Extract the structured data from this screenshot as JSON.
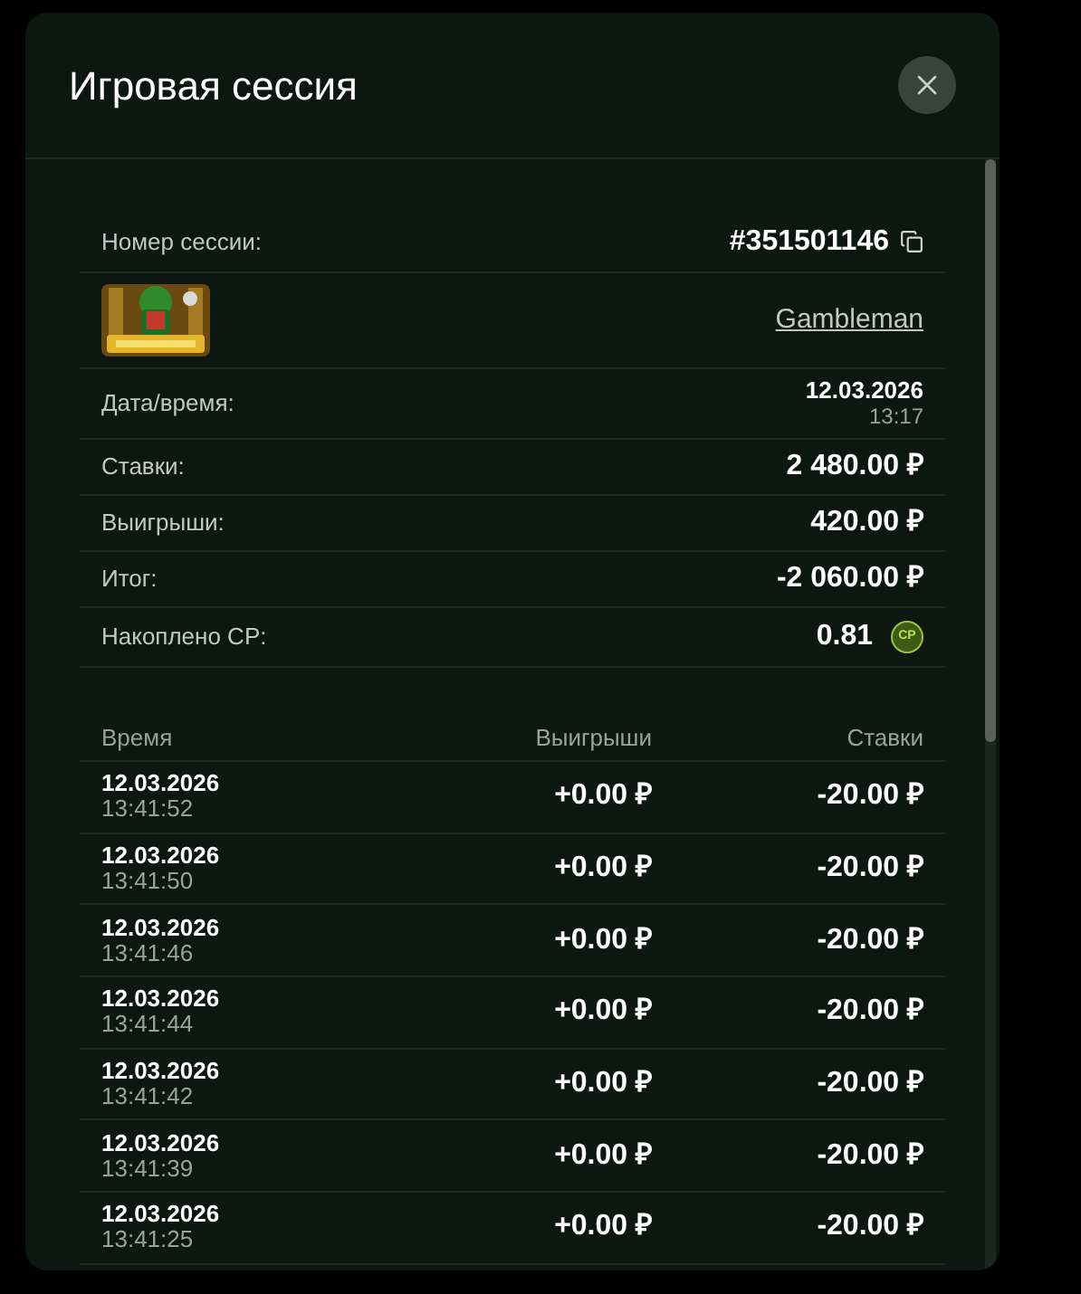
{
  "dialog": {
    "title": "Игровая сессия"
  },
  "session": {
    "number_label": "Номер сессии:",
    "number": "#351501146",
    "game": {
      "name": "Gambleman"
    },
    "details": [
      {
        "label": "Дата/время:",
        "value": "12.03.2026",
        "subvalue": "13:17"
      },
      {
        "label": "Ставки:",
        "value": "2 480.00 ₽"
      },
      {
        "label": "Выигрыши:",
        "value": "420.00 ₽"
      },
      {
        "label": "Итог:",
        "value": "-2 060.00 ₽"
      },
      {
        "label": "Накоплено CP:",
        "value": "0.81",
        "badge": "CP"
      }
    ]
  },
  "history": {
    "columns": [
      "Время",
      "Выигрыши",
      "Ставки"
    ],
    "rows": [
      {
        "date": "12.03.2026",
        "time": "13:41:52",
        "win": "+0.00 ₽",
        "bet": "-20.00 ₽"
      },
      {
        "date": "12.03.2026",
        "time": "13:41:50",
        "win": "+0.00 ₽",
        "bet": "-20.00 ₽"
      },
      {
        "date": "12.03.2026",
        "time": "13:41:46",
        "win": "+0.00 ₽",
        "bet": "-20.00 ₽"
      },
      {
        "date": "12.03.2026",
        "time": "13:41:44",
        "win": "+0.00 ₽",
        "bet": "-20.00 ₽"
      },
      {
        "date": "12.03.2026",
        "time": "13:41:42",
        "win": "+0.00 ₽",
        "bet": "-20.00 ₽"
      },
      {
        "date": "12.03.2026",
        "time": "13:41:39",
        "win": "+0.00 ₽",
        "bet": "-20.00 ₽"
      },
      {
        "date": "12.03.2026",
        "time": "13:41:25",
        "win": "+0.00 ₽",
        "bet": "-20.00 ₽"
      }
    ]
  }
}
